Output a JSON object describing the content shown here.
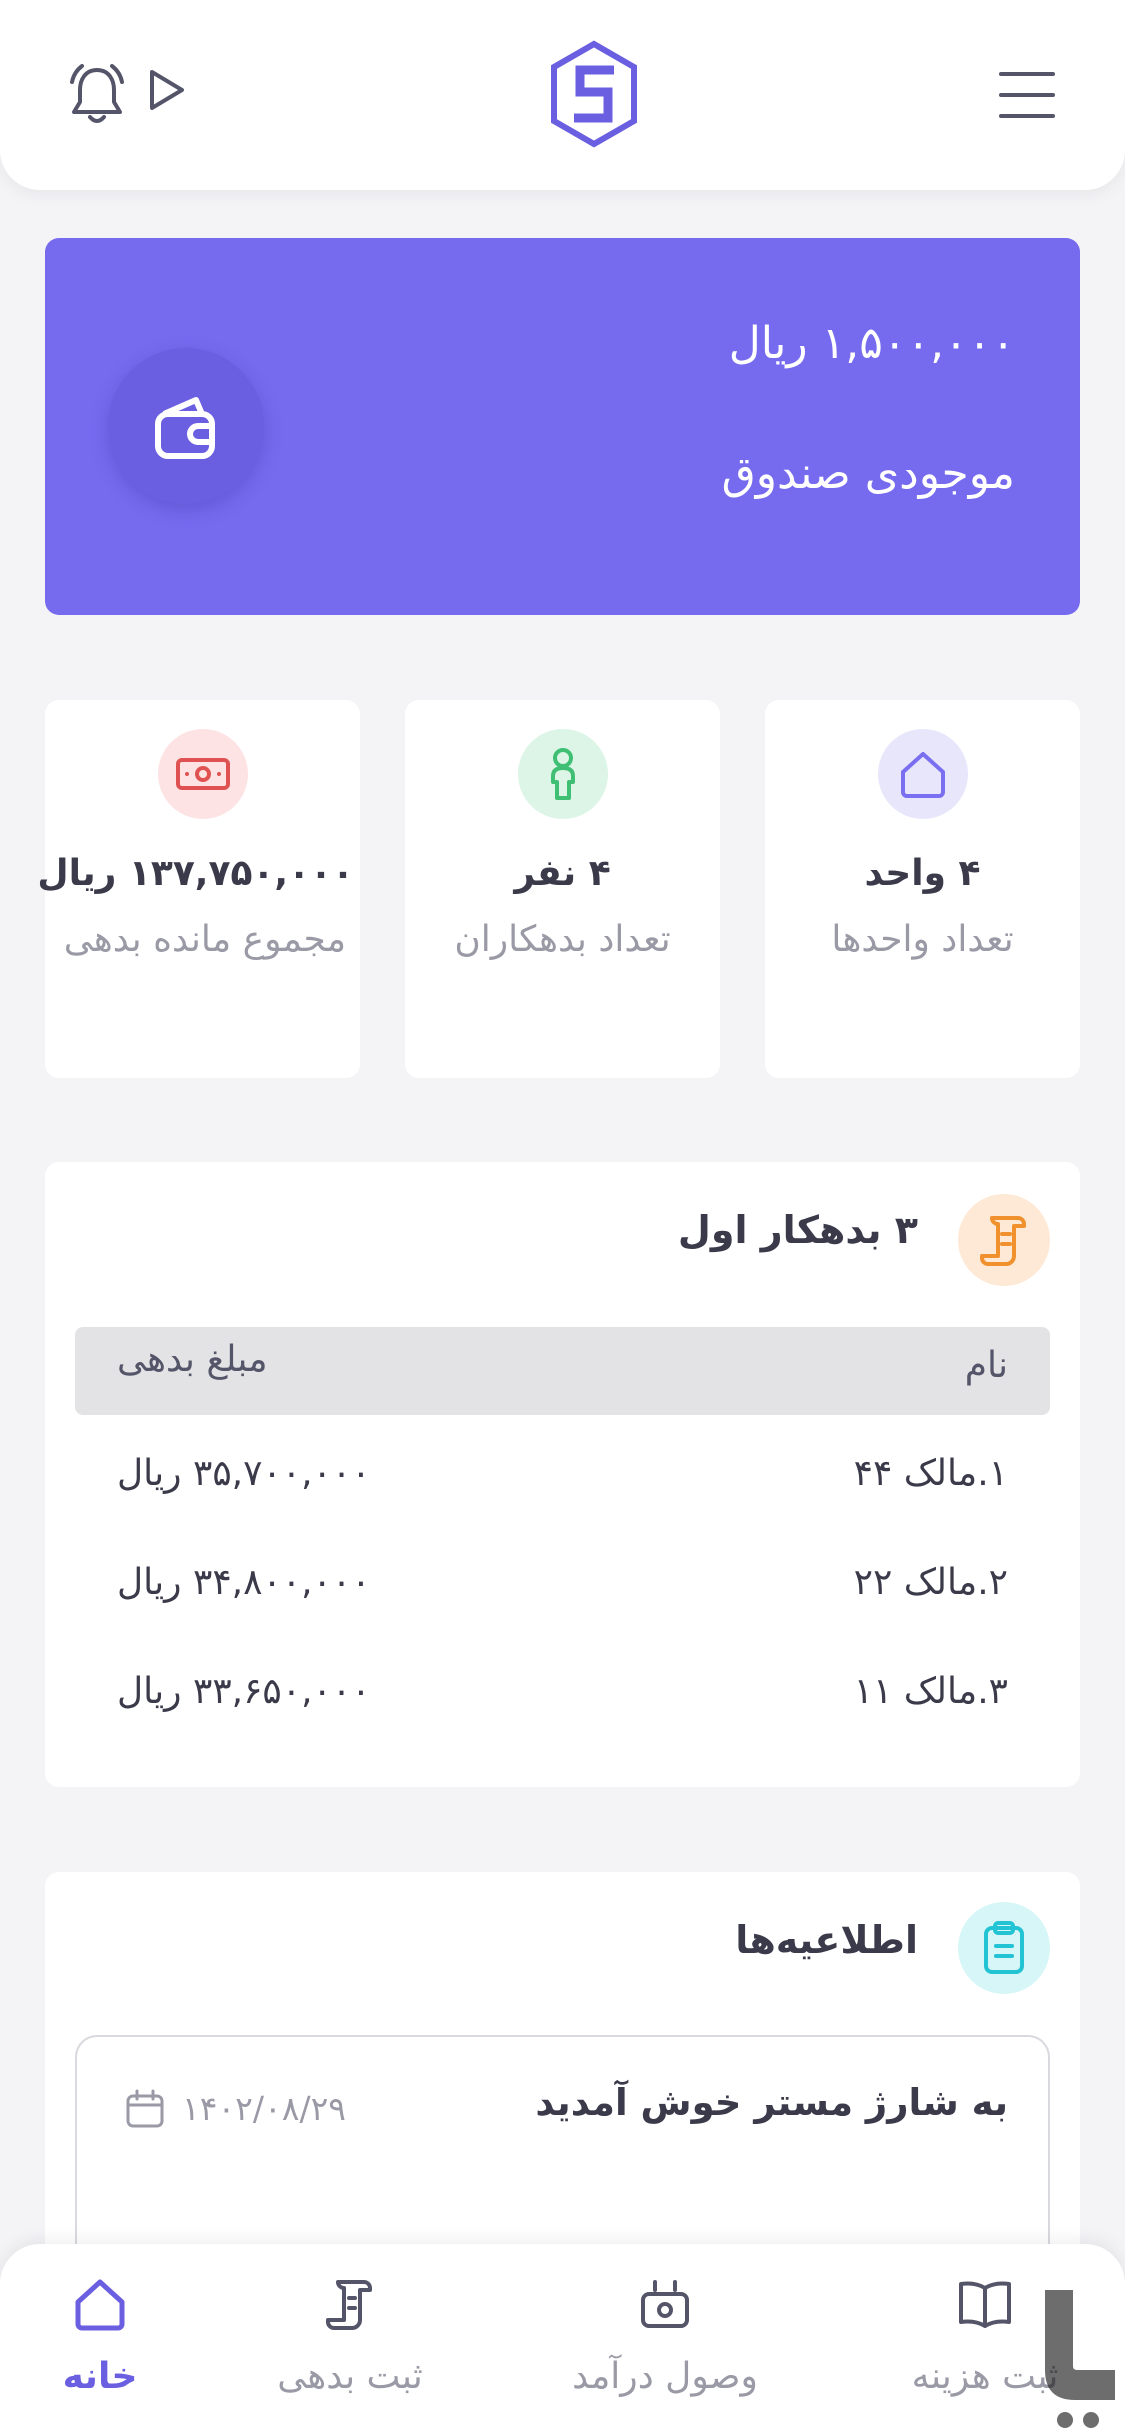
{
  "header": {
    "menu_icon": "hamburger-menu-icon",
    "logo_icon": "s-hexagon-logo",
    "notification_icon": "bell-icon",
    "play_icon": "play-icon"
  },
  "balance": {
    "amount": "۱,۵۰۰,۰۰۰ ریال",
    "label": "موجودی صندوق",
    "icon": "wallet-icon",
    "color": "#766bef"
  },
  "stats": [
    {
      "value": "۴ واحد",
      "caption": "تعداد واحدها",
      "icon": "home-icon",
      "icon_bg": "#e8e6fb",
      "icon_color": "#7a6ff0"
    },
    {
      "value": "۴ نفر",
      "caption": "تعداد بدهکاران",
      "icon": "person-icon",
      "icon_bg": "#dcf5e6",
      "icon_color": "#3fbf73"
    },
    {
      "value": "۱۳۷,۷۵۰,۰۰۰ ریال",
      "caption": "مجموع مانده بدهی",
      "icon": "cash-icon",
      "icon_bg": "#fde3e3",
      "icon_color": "#e05252"
    }
  ],
  "debtors": {
    "title": "۳ بدهکار اول",
    "icon": "receipt-scroll-icon",
    "columns": {
      "name": "نام",
      "amount": "مبلغ بدهی"
    },
    "rows": [
      {
        "name": "۱.مالک ۴۴",
        "amount": "۳۵,۷۰۰,۰۰۰ ریال"
      },
      {
        "name": "۲.مالک ۲۲",
        "amount": "۳۴,۸۰۰,۰۰۰ ریال"
      },
      {
        "name": "۳.مالک ۱۱",
        "amount": "۳۳,۶۵۰,۰۰۰ ریال"
      }
    ]
  },
  "notices": {
    "title": "اطلاعیه‌ها",
    "icon": "clipboard-icon",
    "items": [
      {
        "title": "به شارژ مستر خوش آمدید",
        "date": "۱۴۰۲/۰۸/۲۹"
      }
    ]
  },
  "bottom_nav": [
    {
      "label": "خانه",
      "icon": "home-icon",
      "active": true
    },
    {
      "label": "ثبت بدهی",
      "icon": "receipt-scroll-icon",
      "active": false
    },
    {
      "label": "وصول درآمد",
      "icon": "cash-register-icon",
      "active": false
    },
    {
      "label": "ثبت هزینه",
      "icon": "book-open-icon",
      "active": false
    }
  ],
  "colors": {
    "accent": "#766bef",
    "background": "#f4f4f7"
  }
}
